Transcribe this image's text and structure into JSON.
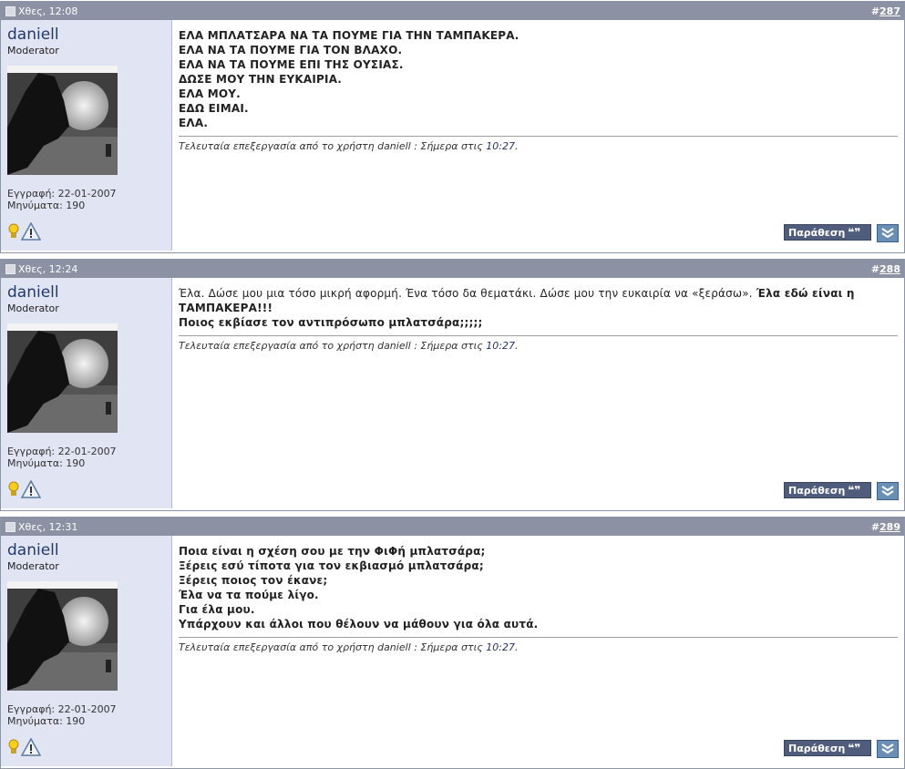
{
  "posts": [
    {
      "date": "Χθες, 12:08",
      "hash": "#",
      "number": "287",
      "username": "daniell",
      "usertitle": "Moderator",
      "joined": "Εγγραφή: 22-01-2007",
      "messages": "Μηνύματα: 190",
      "lines": [
        "ΕΛΑ ΜΠΛΑΤΣΑΡΑ ΝΑ ΤΑ ΠΟΥΜΕ ΓΙΑ ΤΗΝ ΤΑΜΠΑΚΕΡΑ.",
        "ΕΛΑ ΝΑ ΤΑ ΠΟΥΜΕ ΓΙΑ ΤΟΝ ΒΛΑΧΟ.",
        "ΕΛΑ ΝΑ ΤΑ ΠΟΥΜΕ ΕΠΙ ΤΗΣ ΟΥΣΙΑΣ.",
        "ΔΩΣΕ ΜΟΥ ΤΗΝ ΕΥΚΑΙΡΙΑ.",
        "ΕΛΑ ΜΟΥ.",
        "ΕΔΩ ΕΙΜΑΙ.",
        "ΕΛΑ."
      ],
      "edit_prefix": "Τελευταία επεξεργασία από το χρήστη daniell : Σήμερα στις ",
      "edit_time": "10:27",
      "edit_suffix": ".",
      "quote_label": "Παράθεση",
      "quote_mark": "❝❞"
    },
    {
      "date": "Χθες, 12:24",
      "hash": "#",
      "number": "288",
      "username": "daniell",
      "usertitle": "Moderator",
      "joined": "Εγγραφή: 22-01-2007",
      "messages": "Μηνύματα: 190",
      "intro": "Έλα. Δώσε μου μια τόσο μικρή αφορμή. Ένα τόσο δα θεματάκι. Δώσε μου την ευκαιρία να «ξεράσω». ",
      "strong1": "Έλα εδώ είναι η",
      "strong2": "ΤΑΜΠΑΚΕΡΑ!!!",
      "strong3": "Ποιος εκβίασε τον αντιπρόσωπο μπλατσάρα;;;;;",
      "edit_prefix": "Τελευταία επεξεργασία από το χρήστη daniell : Σήμερα στις ",
      "edit_time": "10:27",
      "edit_suffix": ".",
      "quote_label": "Παράθεση",
      "quote_mark": "❝❞"
    },
    {
      "date": "Χθες, 12:31",
      "hash": "#",
      "number": "289",
      "username": "daniell",
      "usertitle": "Moderator",
      "joined": "Εγγραφή: 22-01-2007",
      "messages": "Μηνύματα: 190",
      "lines": [
        "Ποια είναι η σχέση σου με την ΦιΦή μπλατσάρα;",
        "Ξέρεις εσύ τίποτα για τον εκβιασμό μπλατσάρα;",
        "Ξέρεις ποιος τον έκανε;",
        "Έλα να τα πούμε λίγο.",
        "Για έλα μου.",
        "Υπάρχουν και άλλοι που θέλουν να μάθουν για όλα αυτά."
      ],
      "edit_prefix": "Τελευταία επεξεργασία από το χρήστη daniell : Σήμερα στις ",
      "edit_time": "10:27",
      "edit_suffix": ".",
      "quote_label": "Παράθεση",
      "quote_mark": "❝❞"
    }
  ],
  "icons": {
    "status": "post-status-icon",
    "online": "lightbulb-icon",
    "report": "warning-icon",
    "quote": "quote-icon",
    "multiquote": "multiquote-icon"
  }
}
